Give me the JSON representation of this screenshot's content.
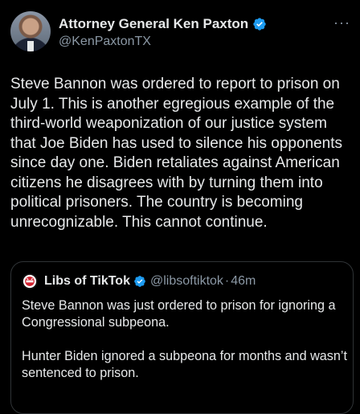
{
  "author": {
    "name": "Attorney General Ken Paxton",
    "handle": "@KenPaxtonTX",
    "more_label": "···"
  },
  "tweet": {
    "text": "Steve Bannon was ordered to report to prison on July 1. This is another egregious example of the third-world weaponization of our justice system that Joe Biden has used to silence his opponents since day one. Biden retaliates against American citizens he disagrees with by turning them into political prisoners. The country is becoming unrecognizable. This cannot continue."
  },
  "quoted": {
    "name": "Libs of TikTok",
    "handle": "@libsoftiktok",
    "separator": "·",
    "time": "46m",
    "paragraph1": "Steve Bannon was just ordered to prison for ignoring a Congressional subpeona.",
    "paragraph2": "Hunter Biden ignored a subpeona for months and wasn’t sentenced to prison."
  },
  "colors": {
    "verified": "#1d9bf0",
    "muted": "#8b98a5",
    "text": "#e7e9ea",
    "background": "#000000"
  },
  "icons": {
    "verified": "verified-badge-icon",
    "more": "more-icon",
    "quoted_avatar": "libs-of-tiktok-logo-icon"
  }
}
